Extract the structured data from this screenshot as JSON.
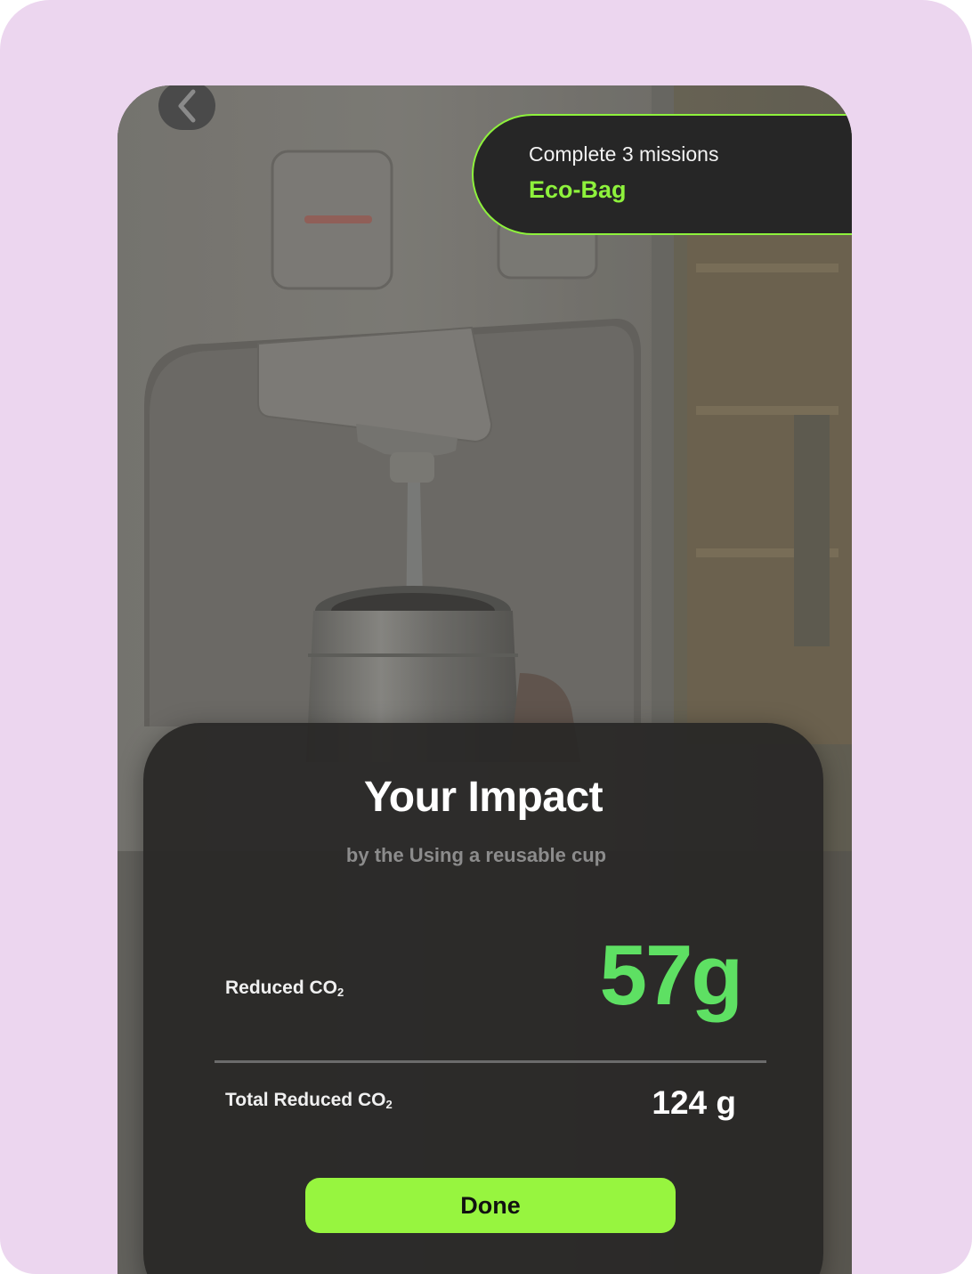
{
  "header": {
    "back_icon": "chevron-left-icon"
  },
  "mission_banner": {
    "title": "Complete 3 missions",
    "reward": "Eco-Bag",
    "accent_color": "#8ef23c"
  },
  "impact_card": {
    "title": "Your Impact",
    "subtitle": "by the Using a reusable cup",
    "reduced_label": "Reduced CO",
    "reduced_label_sub": "2",
    "reduced_value": "57g",
    "total_label": "Total Reduced CO",
    "total_label_sub": "2",
    "total_value": "124 g",
    "value_color": "#5ee063",
    "done_label": "Done",
    "done_color": "#97f53f"
  },
  "background_photo": {
    "subject": "water-dispenser-filling-tumbler"
  }
}
